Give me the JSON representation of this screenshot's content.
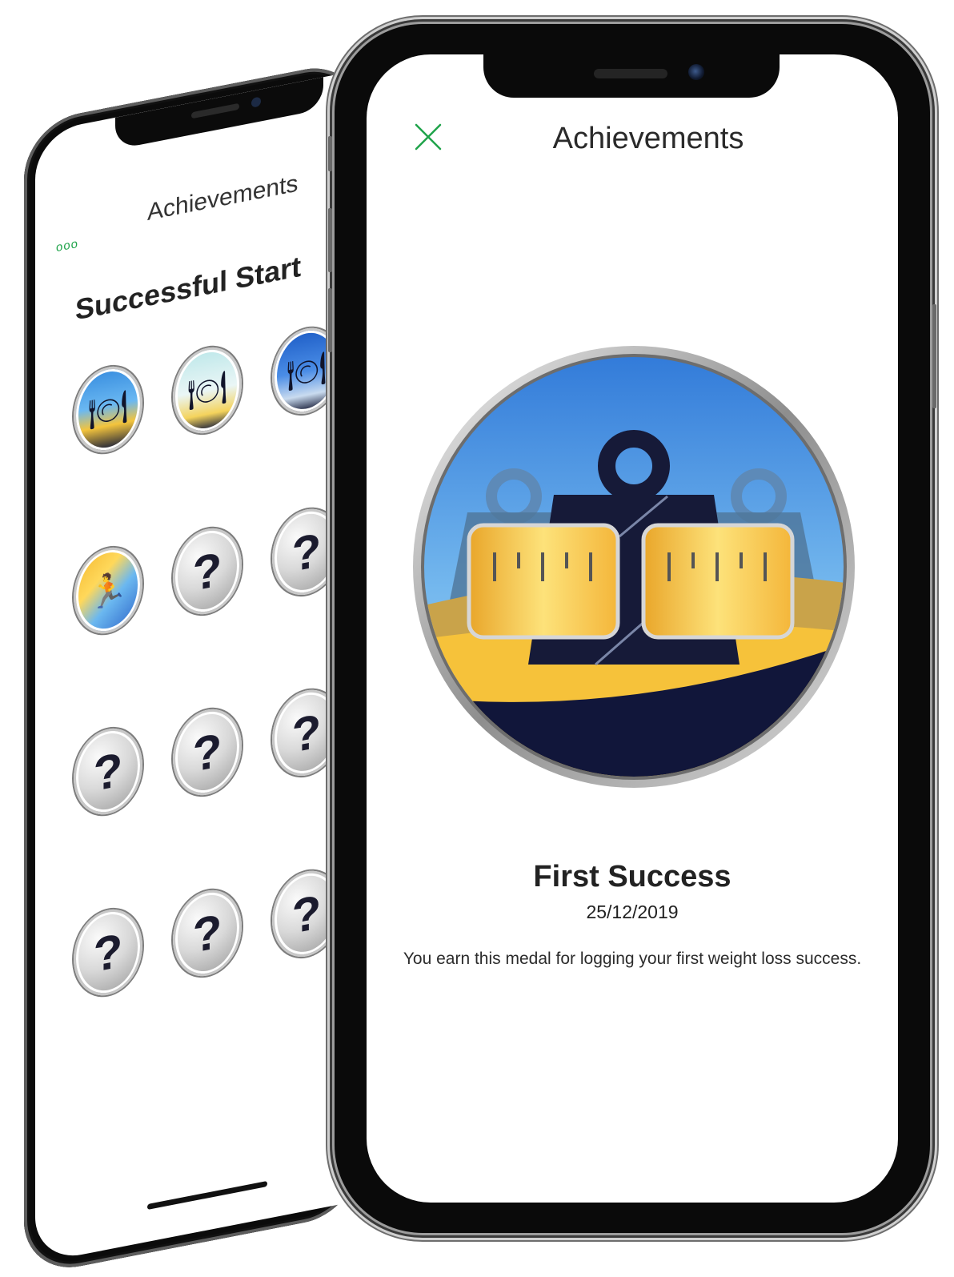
{
  "back_screen": {
    "menu_icon": "ellipsis-icon",
    "menu_glyph": "ooo",
    "title": "Achievements",
    "section_title": "Successful Start",
    "badges": [
      {
        "state": "earned",
        "icon": "breakfast-badge-icon",
        "glyph": "🍽"
      },
      {
        "state": "earned",
        "icon": "lunch-badge-icon",
        "glyph": "🍽"
      },
      {
        "state": "earned",
        "icon": "dinner-badge-icon",
        "glyph": "🍽"
      },
      {
        "state": "earned",
        "icon": "running-badge-icon",
        "glyph": "🏃"
      },
      {
        "state": "locked",
        "icon": "question-mark-icon",
        "glyph": "?"
      },
      {
        "state": "locked",
        "icon": "question-mark-icon",
        "glyph": "?"
      },
      {
        "state": "locked",
        "icon": "question-mark-icon",
        "glyph": "?"
      },
      {
        "state": "locked",
        "icon": "question-mark-icon",
        "glyph": "?"
      },
      {
        "state": "locked",
        "icon": "question-mark-icon",
        "glyph": "?"
      },
      {
        "state": "locked",
        "icon": "question-mark-icon",
        "glyph": "?"
      },
      {
        "state": "locked",
        "icon": "question-mark-icon",
        "glyph": "?"
      },
      {
        "state": "locked",
        "icon": "question-mark-icon",
        "glyph": "?"
      }
    ]
  },
  "front_screen": {
    "close_icon": "close-icon",
    "title": "Achievements",
    "medal_icon": "weight-measuring-tape-medal-icon",
    "medal_name": "First Success",
    "medal_date": "25/12/2019",
    "medal_description": "You earn this medal for logging your first weight loss success."
  },
  "colors": {
    "accent_green": "#1fa34a",
    "sky_blue": "#3d8fe0",
    "tape_yellow": "#f6c93c",
    "navy": "#11163a"
  }
}
